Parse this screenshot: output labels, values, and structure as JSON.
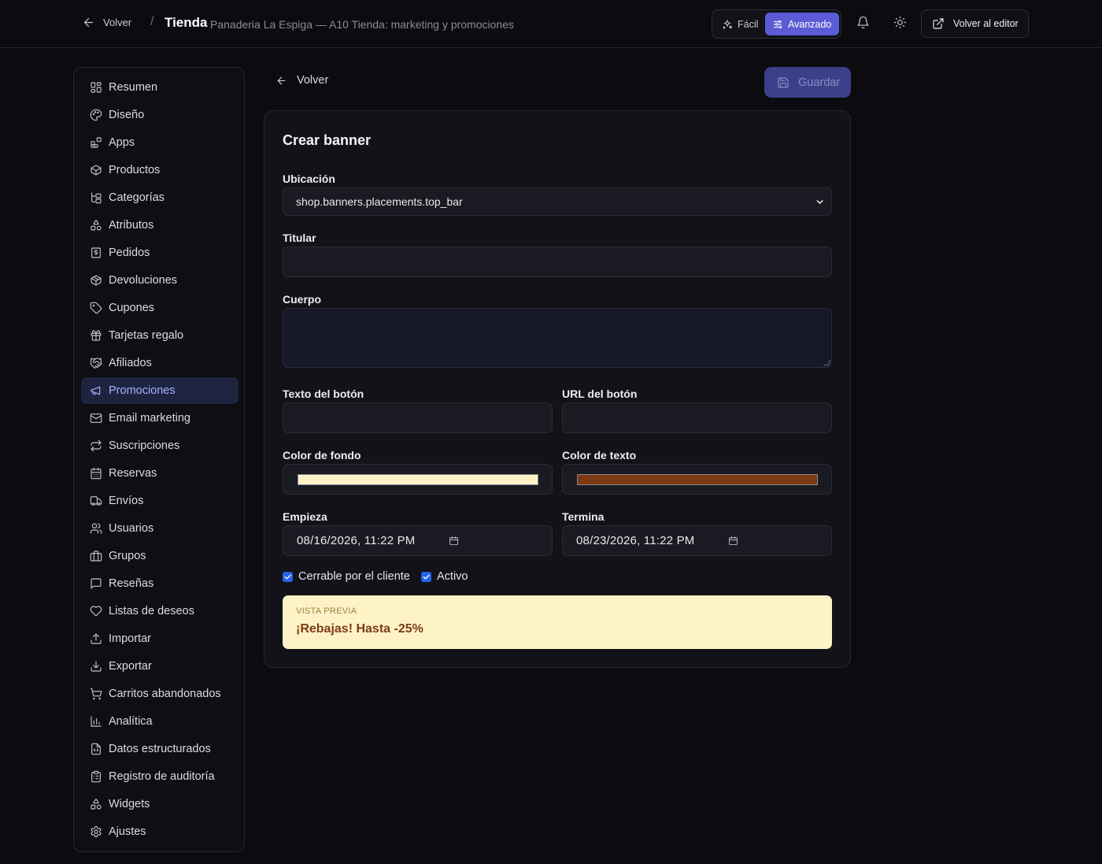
{
  "topbar": {
    "back_label": "Volver",
    "separator": "/",
    "title": "Tienda",
    "subtitle": "Panaderia La Espiga — A10 Tienda: marketing y promociones",
    "mode_easy": "Fácil",
    "mode_advanced": "Avanzado",
    "active_mode": "advanced",
    "editor_button": "Volver al editor"
  },
  "sidebar": {
    "active": "Promociones",
    "items": [
      {
        "label": "Resumen",
        "icon": "dashboard-icon"
      },
      {
        "label": "Diseño",
        "icon": "palette-icon"
      },
      {
        "label": "Apps",
        "icon": "apps-icon"
      },
      {
        "label": "Productos",
        "icon": "box-icon"
      },
      {
        "label": "Categorías",
        "icon": "folder-tree-icon"
      },
      {
        "label": "Atributos",
        "icon": "shapes-icon"
      },
      {
        "label": "Pedidos",
        "icon": "receipt-icon"
      },
      {
        "label": "Devoluciones",
        "icon": "package-return-icon"
      },
      {
        "label": "Cupones",
        "icon": "tag-icon"
      },
      {
        "label": "Tarjetas regalo",
        "icon": "gift-icon"
      },
      {
        "label": "Afiliados",
        "icon": "handshake-icon"
      },
      {
        "label": "Promociones",
        "icon": "megaphone-icon"
      },
      {
        "label": "Email marketing",
        "icon": "mail-icon"
      },
      {
        "label": "Suscripciones",
        "icon": "repeat-icon"
      },
      {
        "label": "Reservas",
        "icon": "calendar-icon"
      },
      {
        "label": "Envíos",
        "icon": "truck-icon"
      },
      {
        "label": "Usuarios",
        "icon": "users-icon"
      },
      {
        "label": "Grupos",
        "icon": "briefcase-icon"
      },
      {
        "label": "Reseñas",
        "icon": "message-square-icon"
      },
      {
        "label": "Listas de deseos",
        "icon": "heart-icon"
      },
      {
        "label": "Importar",
        "icon": "upload-icon"
      },
      {
        "label": "Exportar",
        "icon": "download-icon"
      },
      {
        "label": "Carritos abandonados",
        "icon": "cart-icon"
      },
      {
        "label": "Analítica",
        "icon": "bar-chart-icon"
      },
      {
        "label": "Datos estructurados",
        "icon": "file-code-icon"
      },
      {
        "label": "Registro de auditoría",
        "icon": "clipboard-icon"
      },
      {
        "label": "Widgets",
        "icon": "shapes-icon"
      },
      {
        "label": "Ajustes",
        "icon": "gear-icon"
      }
    ]
  },
  "main": {
    "back_label": "Volver",
    "save_label": "Guardar",
    "card_title": "Crear banner",
    "fields": {
      "placement_label": "Ubicación",
      "placement_value": "shop.banners.placements.top_bar",
      "headline_label": "Titular",
      "headline_value": "",
      "body_label": "Cuerpo",
      "body_value": "",
      "button_text_label": "Texto del botón",
      "button_text_value": "",
      "button_url_label": "URL del botón",
      "button_url_value": "",
      "bg_color_label": "Color de fondo",
      "bg_color": "#fef3c7",
      "text_color_label": "Color de texto",
      "text_color": "#7c3a13",
      "start_label": "Empieza",
      "start_value": "08/16/2026, 11:22 PM",
      "end_label": "Termina",
      "end_value": "08/23/2026, 11:22 PM",
      "closable_label": "Cerrable por el cliente",
      "closable_checked": true,
      "active_label": "Activo",
      "active_checked": true
    },
    "preview": {
      "label": "VISTA PREVIA",
      "text": "¡Rebajas! Hasta -25%"
    }
  },
  "colors": {
    "accent": "#5b5bd6",
    "active_nav_bg": "#1e2340",
    "active_nav_text": "#a5b4fc",
    "save_button_bg": "#3d3f8a"
  }
}
